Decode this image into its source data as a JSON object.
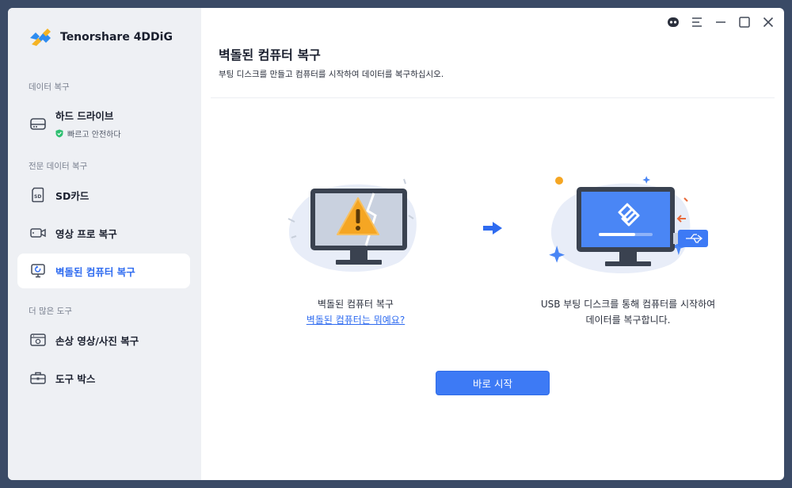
{
  "app": {
    "name": "Tenorshare 4DDiG"
  },
  "sidebar": {
    "section_data_recovery": "데이터 복구",
    "hard_drive": {
      "label": "하드 드라이브",
      "sub": "빠르고 안전하다"
    },
    "section_pro_recovery": "전문 데이터 복구",
    "sd_card": {
      "label": "SD카드"
    },
    "video_pro": {
      "label": "영상 프로 복구"
    },
    "crashed_pc": {
      "label": "벽돌된 컴퓨터 복구"
    },
    "section_more_tools": "더 많은 도구",
    "damaged_media": {
      "label": "손상 영상/사진 복구"
    },
    "toolbox": {
      "label": "도구 박스"
    }
  },
  "main": {
    "title": "벽돌된 컴퓨터 복구",
    "subtitle": "부팅 디스크를 만들고 컴퓨터를 시작하여 데이터를 복구하십시오.",
    "left_caption": "벽돌된 컴퓨터 복구",
    "left_link": "벽돌된 컴퓨터는 뭐예요?",
    "right_caption_line1": "USB 부팅 디스크를 통해 컴퓨터를 시작하여",
    "right_caption_line2": "데이터를 복구합니다.",
    "start_button": "바로 시작"
  },
  "colors": {
    "accent": "#2e6bf0",
    "button": "#3d7af5",
    "sidebar_bg": "#eef0f4",
    "warning": "#f5a623"
  },
  "icons": [
    "hard-drive-icon",
    "shield-check-icon",
    "sd-card-icon",
    "video-camera-icon",
    "crashed-computer-icon",
    "media-repair-icon",
    "toolbox-icon",
    "assistant-icon",
    "menu-icon",
    "minimize-icon",
    "maximize-icon",
    "close-icon",
    "arrow-right-icon"
  ]
}
